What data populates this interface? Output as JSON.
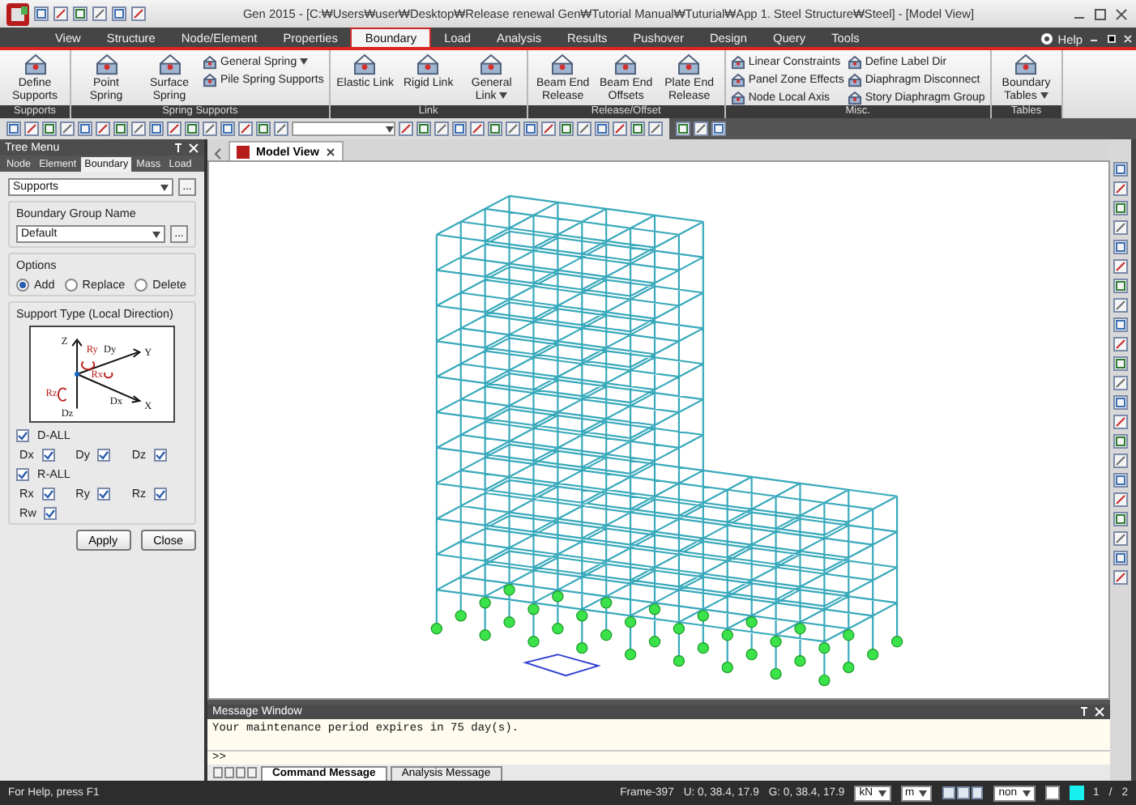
{
  "title_bar": {
    "title": "Gen 2015 - [C:₩Users₩user₩Desktop₩Release renewal Gen₩Tutorial Manual₩Tuturial₩App 1. Steel Structure₩Steel] - [Model View]"
  },
  "menu_tabs": [
    {
      "label": "View",
      "selected": false
    },
    {
      "label": "Structure",
      "selected": false
    },
    {
      "label": "Node/Element",
      "selected": false
    },
    {
      "label": "Properties",
      "selected": false
    },
    {
      "label": "Boundary",
      "selected": true
    },
    {
      "label": "Load",
      "selected": false
    },
    {
      "label": "Analysis",
      "selected": false
    },
    {
      "label": "Results",
      "selected": false
    },
    {
      "label": "Pushover",
      "selected": false
    },
    {
      "label": "Design",
      "selected": false
    },
    {
      "label": "Query",
      "selected": false
    },
    {
      "label": "Tools",
      "selected": false
    }
  ],
  "help": "Help",
  "ribbon": [
    {
      "name": "Supports",
      "buttons": [
        {
          "kind": "large",
          "label": "Define Supports",
          "dropdown": false
        }
      ]
    },
    {
      "name": "Spring Supports",
      "buttons": [
        {
          "kind": "large",
          "label": "Point Spring",
          "dropdown": false
        },
        {
          "kind": "large",
          "label": "Surface Spring",
          "dropdown": false
        },
        {
          "kind": "small",
          "label": "General Spring",
          "dropdown": true
        },
        {
          "kind": "small",
          "label": "Pile Spring Supports",
          "dropdown": false
        }
      ]
    },
    {
      "name": "Link",
      "buttons": [
        {
          "kind": "large",
          "label": "Elastic Link",
          "dropdown": false
        },
        {
          "kind": "large",
          "label": "Rigid Link",
          "dropdown": false
        },
        {
          "kind": "large",
          "label": "General Link",
          "dropdown": true
        }
      ]
    },
    {
      "name": "Release/Offset",
      "buttons": [
        {
          "kind": "large",
          "label": "Beam End Release",
          "dropdown": false
        },
        {
          "kind": "large",
          "label": "Beam End Offsets",
          "dropdown": false
        },
        {
          "kind": "large",
          "label": "Plate End Release",
          "dropdown": false
        }
      ]
    },
    {
      "name": "Misc.",
      "buttons": [
        {
          "kind": "small",
          "label": "Linear Constraints",
          "dropdown": false
        },
        {
          "kind": "small",
          "label": "Panel Zone Effects",
          "dropdown": false
        },
        {
          "kind": "small",
          "label": "Node Local Axis",
          "dropdown": false
        },
        {
          "kind": "small",
          "label": "Define Label Dir",
          "dropdown": false
        },
        {
          "kind": "small",
          "label": "Diaphragm Disconnect",
          "dropdown": false
        },
        {
          "kind": "small",
          "label": "Story Diaphragm Group",
          "dropdown": false
        }
      ]
    },
    {
      "name": "Tables",
      "buttons": [
        {
          "kind": "large",
          "label": "Boundary Tables",
          "dropdown": true
        }
      ]
    }
  ],
  "tree_menu": {
    "title": "Tree Menu",
    "tabs": [
      {
        "label": "Node",
        "selected": false
      },
      {
        "label": "Element",
        "selected": false
      },
      {
        "label": "Boundary",
        "selected": true
      },
      {
        "label": "Mass",
        "selected": false
      },
      {
        "label": "Load",
        "selected": false
      }
    ],
    "function_select": {
      "value": "Supports",
      "button": "..."
    },
    "group_name": {
      "label": "Boundary Group Name",
      "value": "Default",
      "button": "..."
    },
    "options": {
      "label": "Options",
      "choices": [
        {
          "label": "Add",
          "selected": true
        },
        {
          "label": "Replace",
          "selected": false
        },
        {
          "label": "Delete",
          "selected": false
        }
      ]
    },
    "support_type": {
      "label": "Support Type (Local Direction)",
      "diagram_labels": [
        "Z",
        "Ry",
        "Dy",
        "Y",
        "Rx",
        "Rz",
        "Dx",
        "X",
        "Dz"
      ],
      "translation": {
        "all": {
          "label": "D-ALL",
          "checked": true
        },
        "items": [
          {
            "label": "Dx",
            "checked": true
          },
          {
            "label": "Dy",
            "checked": true
          },
          {
            "label": "Dz",
            "checked": true
          }
        ]
      },
      "rotation": {
        "all": {
          "label": "R-ALL",
          "checked": true
        },
        "items": [
          {
            "label": "Rx",
            "checked": true
          },
          {
            "label": "Ry",
            "checked": true
          },
          {
            "label": "Rz",
            "checked": true
          },
          {
            "label": "Rw",
            "checked": true
          }
        ]
      }
    },
    "buttons": [
      "Apply",
      "Close"
    ]
  },
  "view_tab": {
    "label": "Model View"
  },
  "message_window": {
    "title": "Message Window",
    "lines": [
      "Your maintenance period expires in 75 day(s)."
    ],
    "prompt": ">>",
    "tabs": [
      {
        "label": "Command Message",
        "selected": true
      },
      {
        "label": "Analysis Message",
        "selected": false
      }
    ]
  },
  "status_bar": {
    "help": "For Help, press F1",
    "selection": "Frame-397",
    "ucs": "U: 0, 38.4, 17.9",
    "gcs": "G: 0, 38.4, 17.9",
    "force_unit": "kN",
    "length_unit": "m",
    "mode": "non",
    "page": "1",
    "separator": "/",
    "page_count": "2"
  }
}
